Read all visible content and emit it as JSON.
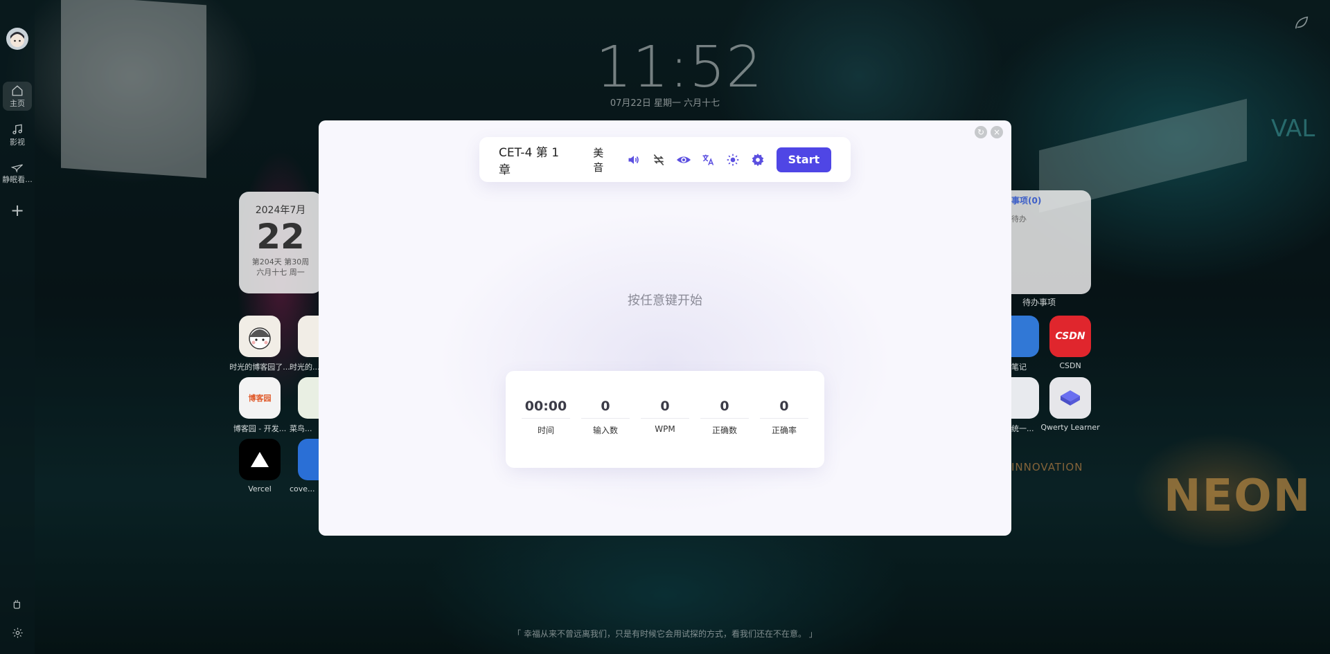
{
  "rail": {
    "items": [
      {
        "label": "主页"
      },
      {
        "label": "影视"
      },
      {
        "label": "静眠看..."
      }
    ]
  },
  "clock": {
    "time": "11:52",
    "date": "07月22日 星期一 六月十七"
  },
  "calendar": {
    "month": "2024年7月",
    "day": "22",
    "sub1": "第204天 第30周",
    "sub2": "六月十七 周一"
  },
  "todo": {
    "title": "事项(0)",
    "subtitle": "待办",
    "label": "待办事项"
  },
  "apps": [
    {
      "name": "时光的博客园了..."
    },
    {
      "name": "时光的..."
    },
    {
      "name": "博客园 - 开发..."
    },
    {
      "name": "菜鸟..."
    },
    {
      "name": "Vercel"
    },
    {
      "name": "cove..."
    },
    {
      "name": "笔记"
    },
    {
      "name": "CSDN"
    },
    {
      "name": "统一..."
    },
    {
      "name": "Qwerty Learner"
    }
  ],
  "modal": {
    "toolbar": {
      "dict_title": "CET-4 第 1 章",
      "accent": "美音",
      "start_label": "Start"
    },
    "hint": "按任意键开始",
    "stats": [
      {
        "value": "00:00",
        "label": "时间"
      },
      {
        "value": "0",
        "label": "输入数"
      },
      {
        "value": "0",
        "label": "WPM"
      },
      {
        "value": "0",
        "label": "正确数"
      },
      {
        "value": "0",
        "label": "正确率"
      }
    ]
  },
  "quote": "「 幸福从来不曾远离我们，只是有时候它会用试探的方式，看我们还在不在意。 」",
  "colors": {
    "accent": "#4f46e5",
    "icon": "#5b4fe0",
    "csdn": "#e0262d"
  }
}
